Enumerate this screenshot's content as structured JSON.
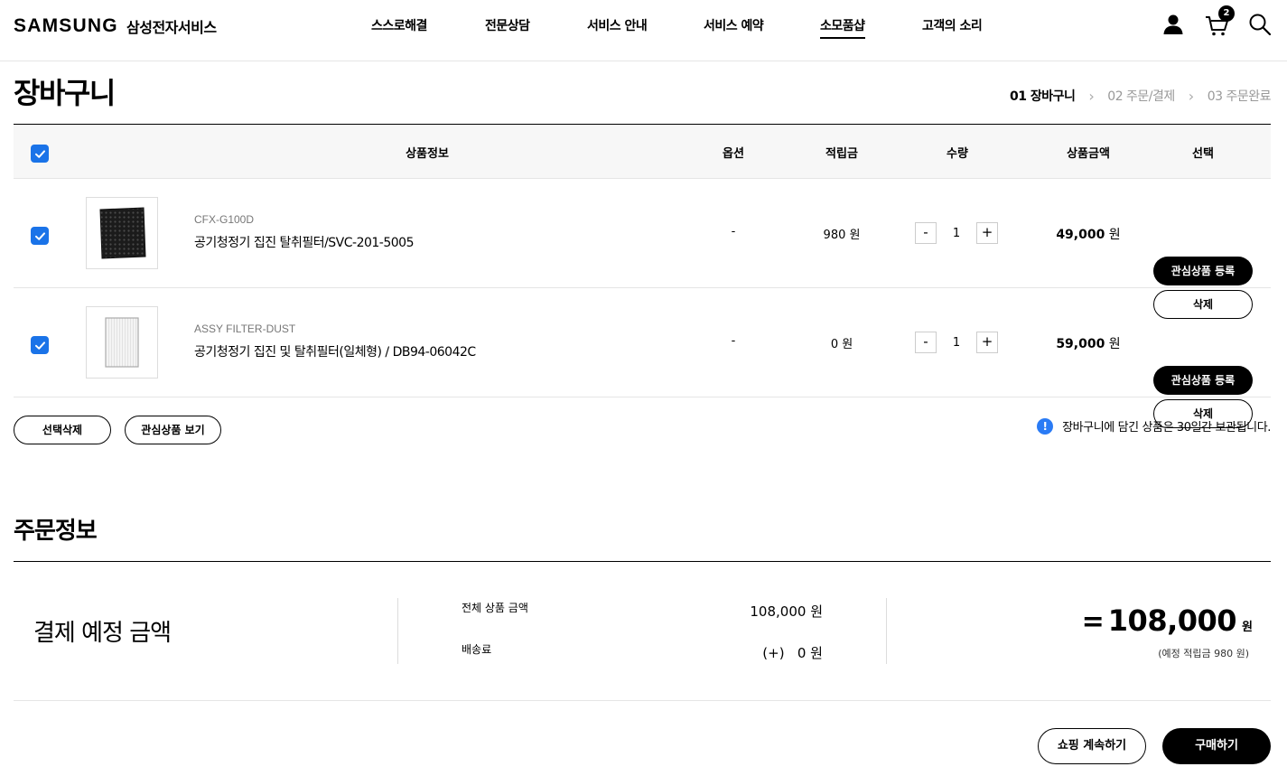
{
  "header": {
    "logo": "SAMSUNG",
    "logo_sub": "삼성전자서비스",
    "nav": [
      "스스로해결",
      "전문상담",
      "서비스 안내",
      "서비스 예약",
      "소모품샵",
      "고객의 소리"
    ],
    "active_nav": "소모품샵",
    "cart_count": "2",
    "icons": [
      "user-icon",
      "cart-icon",
      "search-icon"
    ]
  },
  "page": {
    "title": "장바구니",
    "steps": [
      "01 장바구니",
      "02 주문/결제",
      "03 주문완료"
    ]
  },
  "table": {
    "headers": [
      "상품정보",
      "옵션",
      "적립금",
      "수량",
      "상품금액",
      "선택"
    ]
  },
  "items": [
    {
      "model": "CFX-G100D",
      "name": "공기청정기 집진 탈취필터/SVC-201-5005",
      "option": "-",
      "points": "980 원",
      "qty": "1",
      "price": "49,000",
      "price_unit": "원",
      "wish_label": "관심상품 등록",
      "delete_label": "삭제",
      "checked": true
    },
    {
      "model": "ASSY FILTER-DUST",
      "name": "공기청정기 집진 및 탈취필터(일체형) / DB94-06042C",
      "option": "-",
      "points": "0 원",
      "qty": "1",
      "price": "59,000",
      "price_unit": "원",
      "wish_label": "관심상품 등록",
      "delete_label": "삭제",
      "checked": true
    }
  ],
  "qty_minus": "-",
  "qty_plus": "+",
  "actions": {
    "delete_selected": "선택삭제",
    "view_wishlist": "관심상품 보기",
    "notice": "장바구니에 담긴 상품은 30일간 보관됩니다.",
    "notice_icon": "!"
  },
  "order": {
    "title": "주문정보",
    "pay_label": "결제 예정 금액",
    "subtotal_label": "전체 상품 금액",
    "subtotal_value": "108,000 원",
    "shipping_label": "배송료",
    "shipping_value": "(+)   0 원",
    "total_eq": "=",
    "total_value": "108,000",
    "total_unit": "원",
    "points_note": "(예정 적립금 980 원)"
  },
  "buttons": {
    "continue": "쇼핑 계속하기",
    "buy": "구매하기"
  },
  "colors": {
    "checkbox": "#1a73e8",
    "info": "#2a7bf5",
    "primary": "#000000"
  }
}
